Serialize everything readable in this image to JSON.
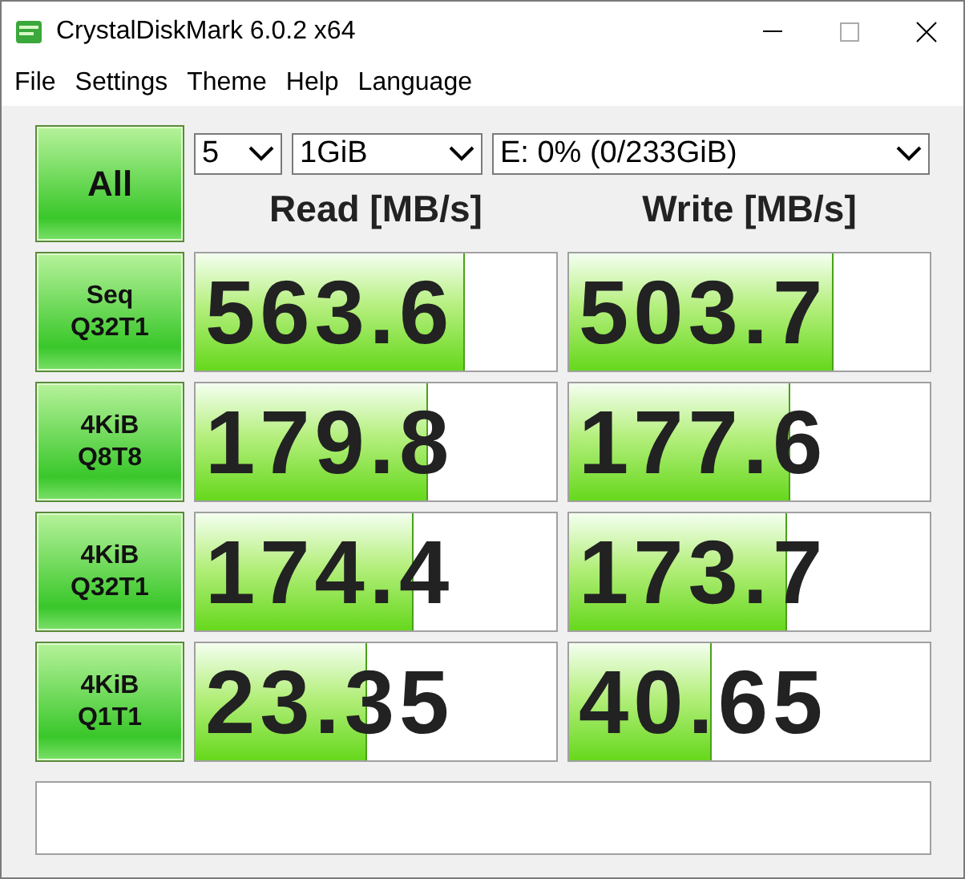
{
  "window": {
    "title": "CrystalDiskMark 6.0.2 x64"
  },
  "menu": [
    "File",
    "Settings",
    "Theme",
    "Help",
    "Language"
  ],
  "all_button": "All",
  "selects": [
    {
      "value": "5"
    },
    {
      "value": "1GiB"
    },
    {
      "value": "E: 0% (0/233GiB)"
    }
  ],
  "headers": [
    "Read [MB/s]",
    "Write [MB/s]"
  ],
  "tests": [
    {
      "lines": [
        "Seq",
        "Q32T1"
      ],
      "read": {
        "value": "563.6",
        "level": 0.74
      },
      "write": {
        "value": "503.7",
        "level": 0.73
      }
    },
    {
      "lines": [
        "4KiB",
        "Q8T8"
      ],
      "read": {
        "value": "179.8",
        "level": 0.64
      },
      "write": {
        "value": "177.6",
        "level": 0.61
      }
    },
    {
      "lines": [
        "4KiB",
        "Q32T1"
      ],
      "read": {
        "value": "174.4",
        "level": 0.6
      },
      "write": {
        "value": "173.7",
        "level": 0.6
      }
    },
    {
      "lines": [
        "4KiB",
        "Q1T1"
      ],
      "read": {
        "value": "23.35",
        "level": 0.47
      },
      "write": {
        "value": "40.65",
        "level": 0.39
      }
    }
  ]
}
